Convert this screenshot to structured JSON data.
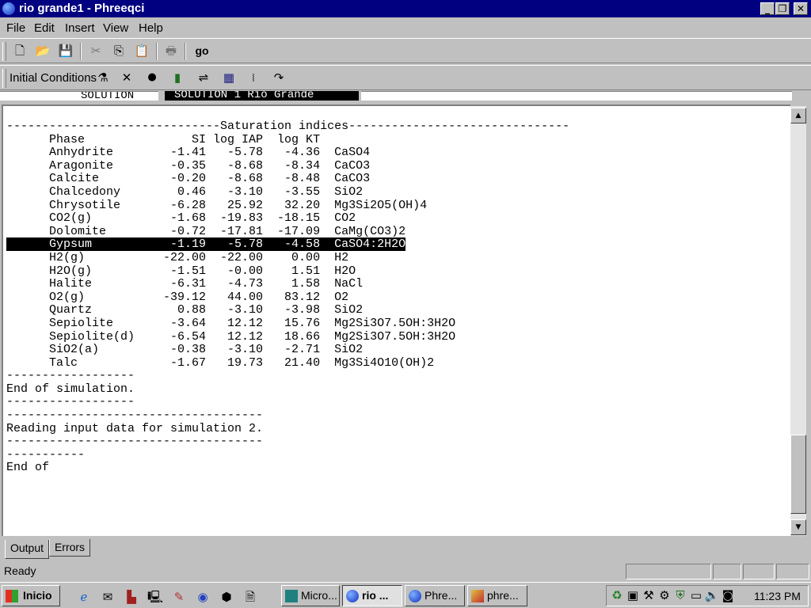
{
  "window": {
    "title": "rio grande1 - Phreeqci"
  },
  "menu": [
    "File",
    "Edit",
    "Insert",
    "View",
    "Help"
  ],
  "toolbar": {
    "go_label": "go"
  },
  "toolbar2": {
    "label": "Initial Conditions"
  },
  "tree": {
    "text": "SOLUTION 1 Rio Grande",
    "left_text": "SOLUTION"
  },
  "output": {
    "lines": [
      "------------------------------Saturation indices-------------------------------",
      "",
      "      Phase               SI log IAP  log KT",
      "",
      "      Anhydrite        -1.41   -5.78   -4.36  CaSO4",
      "      Aragonite        -0.35   -8.68   -8.34  CaCO3",
      "      Calcite          -0.20   -8.68   -8.48  CaCO3",
      "      Chalcedony        0.46   -3.10   -3.55  SiO2",
      "      Chrysotile       -6.28   25.92   32.20  Mg3Si2O5(OH)4",
      "      CO2(g)           -1.68  -19.83  -18.15  CO2",
      "      Dolomite         -0.72  -17.81  -17.09  CaMg(CO3)2",
      "      Gypsum           -1.19   -5.78   -4.58  CaSO4:2H2O",
      "      H2(g)           -22.00  -22.00    0.00  H2",
      "      H2O(g)           -1.51   -0.00    1.51  H2O",
      "      Halite           -6.31   -4.73    1.58  NaCl",
      "      O2(g)           -39.12   44.00   83.12  O2",
      "      Quartz            0.88   -3.10   -3.98  SiO2",
      "      Sepiolite        -3.64   12.12   15.76  Mg2Si3O7.5OH:3H2O",
      "      Sepiolite(d)     -6.54   12.12   18.66  Mg2Si3O7.5OH:3H2O",
      "      SiO2(a)          -0.38   -3.10   -2.71  SiO2",
      "      Talc             -1.67   19.73   21.40  Mg3Si4O10(OH)2",
      "",
      "",
      "------------------",
      "End of simulation.",
      "------------------",
      "",
      "",
      "------------------------------------",
      "Reading input data for simulation 2.",
      "------------------------------------",
      "",
      "",
      "-----------",
      "End of "
    ],
    "selected_line": 11
  },
  "tabs": [
    "Output",
    "Errors"
  ],
  "status": {
    "text": "Ready"
  },
  "taskbar": {
    "start_label": "Inicio",
    "tasks": [
      "Micro...",
      "rio ...",
      "Phre...",
      "phre..."
    ],
    "clock": "11:23 PM"
  },
  "colors": {
    "titlebar": "#000080",
    "face": "#c0c0c0",
    "selection": "#000000"
  }
}
